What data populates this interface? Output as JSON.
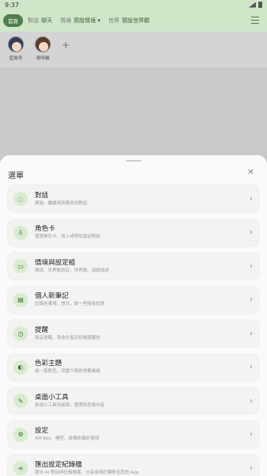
{
  "status": {
    "time": "9:37"
  },
  "header": {
    "home_label": "首頁",
    "crumbs": [
      {
        "label": "對話",
        "value": "聊天"
      },
      {
        "label": "情境",
        "value": "預設情境 ▾"
      },
      {
        "label": "世界",
        "value": "預設世界觀"
      }
    ]
  },
  "characters": [
    {
      "name": "藍裝青"
    },
    {
      "name": "咖啡貓"
    }
  ],
  "add_character": "+",
  "sheet": {
    "title": "選單",
    "close": "×",
    "items": [
      {
        "icon": "chat-icon",
        "glyph": "◌",
        "title": "對話",
        "subtitle": "開始、繼續或新建會話對話"
      },
      {
        "icon": "people-icon",
        "glyph": "♙",
        "title": "角色卡",
        "subtitle": "管理角色卡，加入或移除當前對話"
      },
      {
        "icon": "folder-icon",
        "glyph": "▭",
        "title": "情境與設定組",
        "subtitle": "情境、世界觀設定、世界觀、用語描述"
      },
      {
        "icon": "notebook-icon",
        "glyph": "▤",
        "title": "個人新筆記",
        "subtitle": "記錄各事項、想法，做一些隨身紀錄"
      },
      {
        "icon": "alarm-icon",
        "glyph": "◷",
        "title": "提醒",
        "subtitle": "設定提醒，我會在指定時間提醒你"
      },
      {
        "icon": "palette-icon",
        "glyph": "◐",
        "title": "色彩主題",
        "subtitle": "換一套配色，改變介面的視覺風格"
      },
      {
        "icon": "tool-icon",
        "glyph": "✎",
        "title": "桌面小工具",
        "subtitle": "新增小工具到桌面，管理和查看內容"
      },
      {
        "icon": "gear-icon",
        "glyph": "⚙",
        "title": "設定",
        "subtitle": "API Key、模型、設備和偏好選項"
      },
      {
        "icon": "share-icon",
        "glyph": "⋖",
        "title": "匯出設定紀錄檔",
        "subtitle": "匯出 AI 對話與記錄檔案，分享或用於轉移至其他 App"
      }
    ]
  }
}
